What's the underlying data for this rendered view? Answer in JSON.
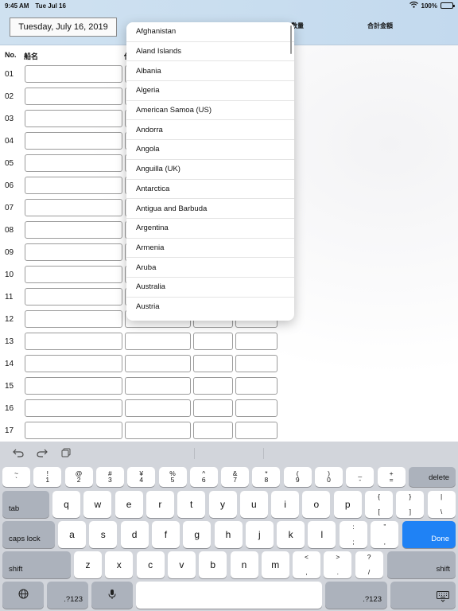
{
  "status_bar": {
    "time": "9:45 AM",
    "date": "Tue Jul 16",
    "battery": "100%"
  },
  "header": {
    "date_button": "Tuesday, July 16, 2019",
    "qty_label": "数量",
    "total_label": "合計金額"
  },
  "table": {
    "col_no": "No.",
    "col_name": "船名",
    "col_c": "仕",
    "rows": [
      "01",
      "02",
      "03",
      "04",
      "05",
      "06",
      "07",
      "08",
      "09",
      "10",
      "11",
      "12",
      "13",
      "14",
      "15",
      "16",
      "17"
    ]
  },
  "dropdown": {
    "options": [
      "Afghanistan",
      "Aland Islands",
      "Albania",
      "Algeria",
      "American Samoa (US)",
      "Andorra",
      "Angola",
      "Anguilla (UK)",
      "Antarctica",
      "Antigua and Barbuda",
      "Argentina",
      "Armenia",
      "Aruba",
      "Australia",
      "Austria"
    ]
  },
  "keyboard": {
    "toolbar_icons": [
      "undo-icon",
      "redo-icon",
      "clipboard-icon"
    ],
    "row1": [
      {
        "t": "~",
        "b": "`"
      },
      {
        "t": "!",
        "b": "1"
      },
      {
        "t": "@",
        "b": "2"
      },
      {
        "t": "#",
        "b": "3"
      },
      {
        "t": "¥",
        "b": "4"
      },
      {
        "t": "%",
        "b": "5"
      },
      {
        "t": "^",
        "b": "6"
      },
      {
        "t": "&",
        "b": "7"
      },
      {
        "t": "*",
        "b": "8"
      },
      {
        "t": "(",
        "b": "9"
      },
      {
        "t": ")",
        "b": "0"
      },
      {
        "t": "_",
        "b": "-"
      },
      {
        "t": "+",
        "b": "="
      }
    ],
    "delete": "delete",
    "tab": "tab",
    "row2": [
      "q",
      "w",
      "e",
      "r",
      "t",
      "y",
      "u",
      "i",
      "o",
      "p"
    ],
    "row2_sym": [
      {
        "t": "{",
        "b": "["
      },
      {
        "t": "}",
        "b": "]"
      },
      {
        "t": "|",
        "b": "\\"
      }
    ],
    "caps": "caps lock",
    "row3": [
      "a",
      "s",
      "d",
      "f",
      "g",
      "h",
      "j",
      "k",
      "l"
    ],
    "row3_sym": [
      {
        "t": ":",
        "b": ";"
      },
      {
        "t": "”",
        "b": ","
      }
    ],
    "done": "Done",
    "shift": "shift",
    "row4": [
      "z",
      "x",
      "c",
      "v",
      "b",
      "n",
      "m"
    ],
    "row4_sym": [
      {
        "t": "<",
        "b": ","
      },
      {
        "t": ">",
        "b": "."
      },
      {
        "t": "?",
        "b": "/"
      }
    ],
    "num_label": ".?123"
  }
}
